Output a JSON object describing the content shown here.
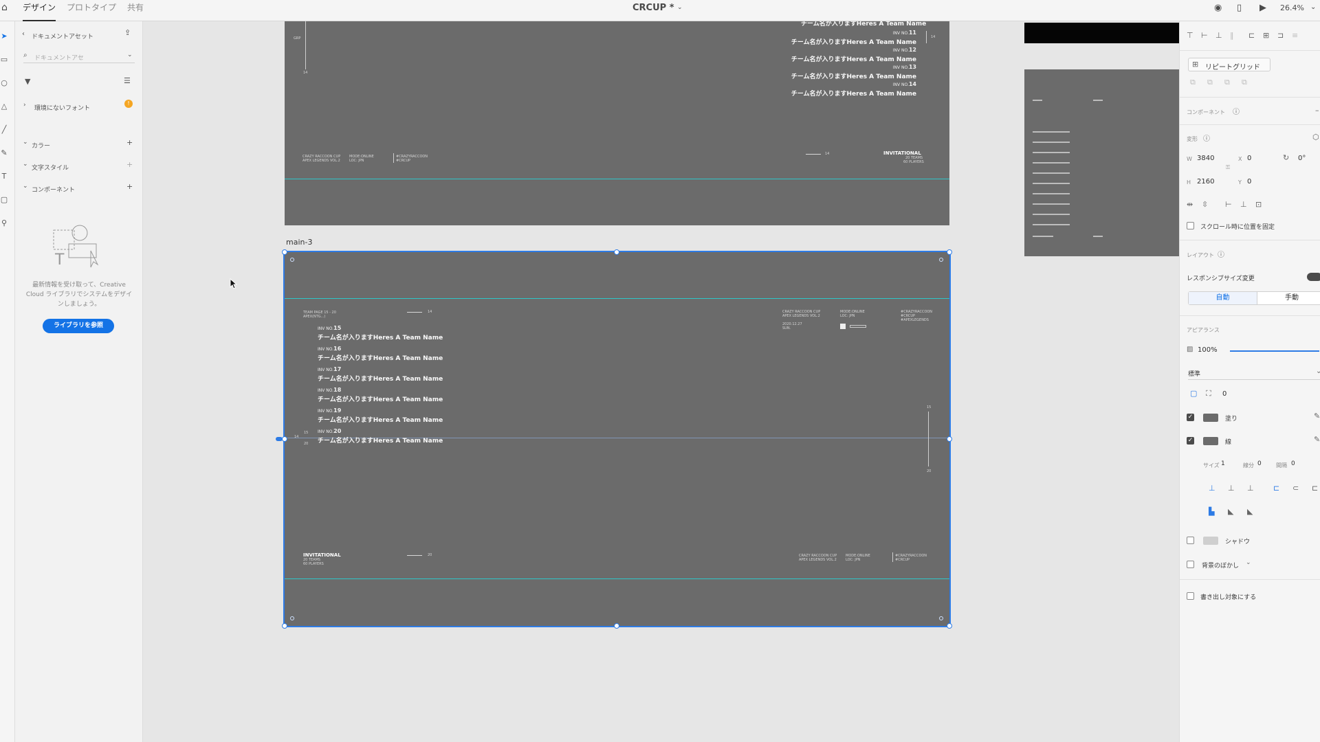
{
  "topbar": {
    "tabs": [
      "デザイン",
      "プロトタイプ",
      "共有"
    ],
    "title": "CRCUP *",
    "zoom": "26.4%"
  },
  "assets": {
    "back_label": "ドキュメントアセット",
    "search_placeholder": "ドキュメントアセ",
    "missing_fonts": "環境にないフォント",
    "warn_count": "!",
    "sections": [
      "カラー",
      "文字スタイル",
      "コンポーネント"
    ],
    "empty_text": [
      "最新情報を受け取って、Creative",
      "Cloud ライブラリでシステムをデザイ",
      "ンしましょう。"
    ],
    "library_button": "ライブラリを参照"
  },
  "canvas": {
    "artboard_label": "main-3",
    "top_teams": [
      {
        "no": "11",
        "name": "チーム名が入りますHeres A Team Name"
      },
      {
        "no": "12",
        "name": "チーム名が入りますHeres A Team Name"
      },
      {
        "no": "13",
        "name": "チーム名が入りますHeres A Team Name"
      },
      {
        "no": "14",
        "name": "チーム名が入りますHeres A Team Name"
      }
    ],
    "top_partial_name": "チーム名が入りますHeres A Team Name",
    "bottom_teams": [
      {
        "no": "15",
        "name": "チーム名が入りますHeres A Team Name"
      },
      {
        "no": "16",
        "name": "チーム名が入りますHeres A Team Name"
      },
      {
        "no": "17",
        "name": "チーム名が入りますHeres A Team Name"
      },
      {
        "no": "18",
        "name": "チーム名が入りますHeres A Team Name"
      },
      {
        "no": "19",
        "name": "チーム名が入りますHeres A Team Name"
      },
      {
        "no": "20",
        "name": "チーム名が入りますHeres A Team Name"
      }
    ],
    "inv_prefix": "INV NO.",
    "invitational": "INVITATIONAL",
    "teams_line": "20 TEAMS",
    "players_line": "60 PLAYERS",
    "grp": "GRP",
    "num_14": "14",
    "num_15": "15",
    "num_20": "20",
    "cup_lines": [
      "CRAZY RACCOON CUP",
      "APEX LEGENDS VOL.2"
    ],
    "date_lines": [
      "2020.12.27",
      "SUN."
    ],
    "mode_lines": [
      "MODE:ONLINE",
      "LOC: JPN"
    ],
    "tags": [
      "#CRAZYRACCOON",
      "#CRCUP",
      "#APEXLEGENDS"
    ],
    "team_header": [
      "TEAM PAGE 15 - 20",
      "APEX(NTG...)"
    ]
  },
  "props": {
    "repeat_grid": "リピートグリッド",
    "component": "コンポーネント",
    "transform": "変形",
    "w_label": "W",
    "w_val": "3840",
    "h_label": "H",
    "h_val": "2160",
    "x_label": "X",
    "x_val": "0",
    "y_label": "Y",
    "y_val": "0",
    "rotation": "0°",
    "fix_scroll": "スクロール時に位置を固定",
    "layout": "レイアウト",
    "responsive": "レスポンシブサイズ変更",
    "auto": "自動",
    "manual": "手動",
    "appearance": "アピアランス",
    "opacity": "100%",
    "blend": "標準",
    "radius": "0",
    "fill": "塗り",
    "border": "線",
    "size_label": "サイズ",
    "size_val": "1",
    "dash_label": "線分",
    "dash_val": "0",
    "gap_label": "間隔",
    "gap_val": "0",
    "shadow": "シャドウ",
    "bg_blur": "背景のぼかし",
    "export": "書き出し対象にする",
    "colors": {
      "fill": "#6b6b6b",
      "accent": "#1473e6",
      "cyan": "#2ec7c9"
    }
  }
}
